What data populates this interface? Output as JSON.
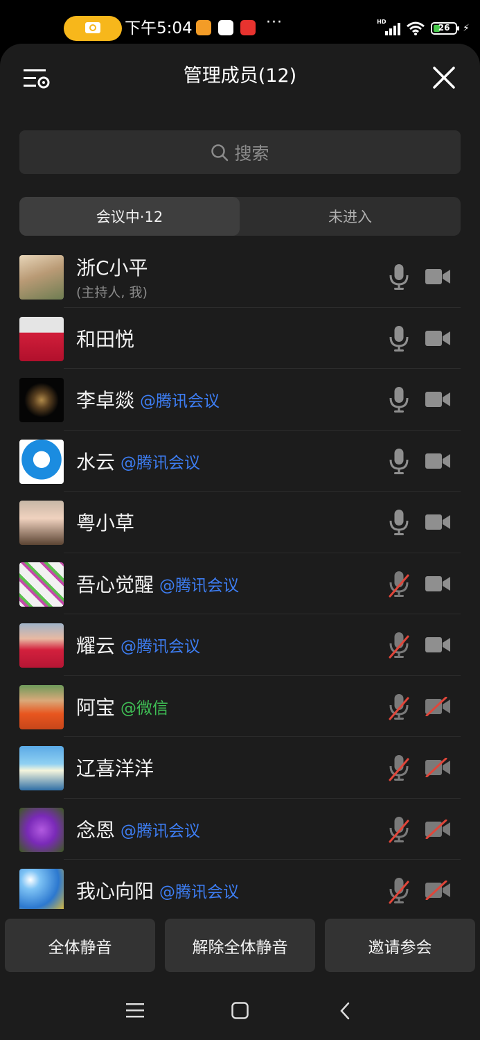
{
  "status_bar": {
    "time": "下午5:04",
    "dots": "···",
    "network": "HD",
    "battery": "26"
  },
  "header": {
    "title": "管理成员(12)"
  },
  "search": {
    "placeholder": "搜索"
  },
  "tabs": [
    {
      "label": "会议中·12",
      "active": true
    },
    {
      "label": "未进入",
      "active": false
    }
  ],
  "members": [
    {
      "name": "浙C小平",
      "role": "(主持人, 我)",
      "tag": "",
      "tag_color": "",
      "mic_on": true,
      "camera_on": true
    },
    {
      "name": "和田悦",
      "role": "",
      "tag": "",
      "tag_color": "",
      "mic_on": true,
      "camera_on": true
    },
    {
      "name": "李卓燚",
      "role": "",
      "tag": "@腾讯会议",
      "tag_color": "blue",
      "mic_on": true,
      "camera_on": true
    },
    {
      "name": "水云",
      "role": "",
      "tag": "@腾讯会议",
      "tag_color": "blue",
      "mic_on": true,
      "camera_on": true
    },
    {
      "name": "粤小草",
      "role": "",
      "tag": "",
      "tag_color": "",
      "mic_on": true,
      "camera_on": true
    },
    {
      "name": "吾心觉醒",
      "role": "",
      "tag": "@腾讯会议",
      "tag_color": "blue",
      "mic_on": false,
      "camera_on": true
    },
    {
      "name": "耀云",
      "role": "",
      "tag": "@腾讯会议",
      "tag_color": "blue",
      "mic_on": false,
      "camera_on": true
    },
    {
      "name": "阿宝",
      "role": "",
      "tag": "@微信",
      "tag_color": "green",
      "mic_on": false,
      "camera_on": false
    },
    {
      "name": "辽喜洋洋",
      "role": "",
      "tag": "",
      "tag_color": "",
      "mic_on": false,
      "camera_on": false
    },
    {
      "name": "念恩",
      "role": "",
      "tag": "@腾讯会议",
      "tag_color": "blue",
      "mic_on": false,
      "camera_on": false
    },
    {
      "name": "我心向阳",
      "role": "",
      "tag": "@腾讯会议",
      "tag_color": "blue",
      "mic_on": false,
      "camera_on": false
    }
  ],
  "actions": {
    "mute_all": "全体静音",
    "unmute_all": "解除全体静音",
    "invite": "邀请参会"
  },
  "colors": {
    "panel_bg": "#1c1c1c",
    "accent_blue": "#3d7df2",
    "wechat_green": "#3fbf55",
    "muted_red": "#e0463a",
    "recording_pill": "#f7b71b"
  }
}
